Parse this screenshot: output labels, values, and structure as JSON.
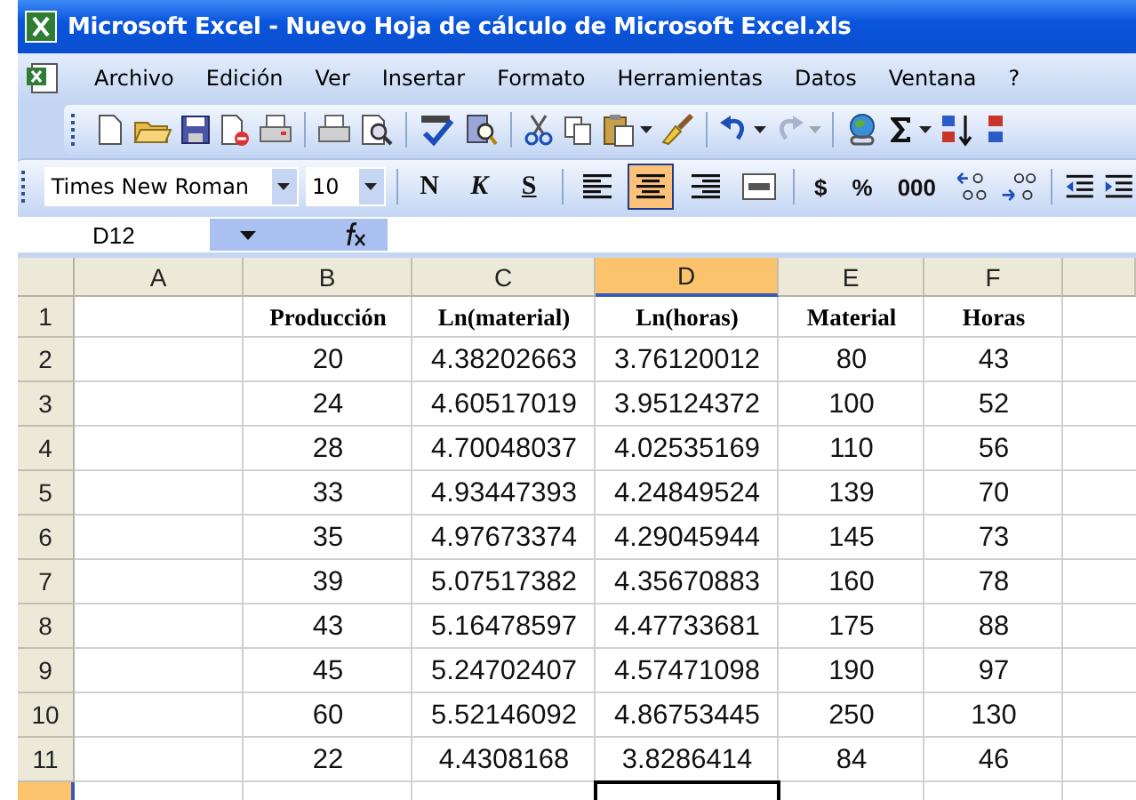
{
  "window": {
    "title": "Microsoft Excel - Nuevo Hoja de cálculo de Microsoft Excel.xls"
  },
  "menu": [
    {
      "label": "Archivo"
    },
    {
      "label": "Edición"
    },
    {
      "label": "Ver"
    },
    {
      "label": "Insertar"
    },
    {
      "label": "Formato"
    },
    {
      "label": "Herramientas"
    },
    {
      "label": "Datos"
    },
    {
      "label": "Ventana"
    },
    {
      "label": "?"
    }
  ],
  "formatting_toolbar": {
    "font": "Times New Roman",
    "size": "10",
    "style_buttons": [
      "N",
      "K",
      "S"
    ],
    "alignment": [
      {
        "kind": "left",
        "selected": false
      },
      {
        "kind": "center",
        "selected": true
      },
      {
        "kind": "right",
        "selected": false
      },
      {
        "kind": "merge",
        "selected": false
      }
    ],
    "number_buttons": [
      "$",
      "%",
      "000"
    ]
  },
  "name_box": "D12",
  "columns": [
    {
      "label": "A",
      "selected": false
    },
    {
      "label": "B",
      "selected": false
    },
    {
      "label": "C",
      "selected": false
    },
    {
      "label": "D",
      "selected": true
    },
    {
      "label": "E",
      "selected": false
    },
    {
      "label": "F",
      "selected": false
    }
  ],
  "rows": [
    {
      "number": "1",
      "selected": false,
      "kind": "header",
      "cells": [
        "Producción",
        "Ln(material)",
        "Ln(horas)",
        "Material",
        "Horas"
      ]
    },
    {
      "number": "2",
      "selected": false,
      "kind": "data",
      "cells": [
        "20",
        "4.38202663",
        "3.76120012",
        "80",
        "43"
      ]
    },
    {
      "number": "3",
      "selected": false,
      "kind": "data",
      "cells": [
        "24",
        "4.60517019",
        "3.95124372",
        "100",
        "52"
      ]
    },
    {
      "number": "4",
      "selected": false,
      "kind": "data",
      "cells": [
        "28",
        "4.70048037",
        "4.02535169",
        "110",
        "56"
      ]
    },
    {
      "number": "5",
      "selected": false,
      "kind": "data",
      "cells": [
        "33",
        "4.93447393",
        "4.24849524",
        "139",
        "70"
      ]
    },
    {
      "number": "6",
      "selected": false,
      "kind": "data",
      "cells": [
        "35",
        "4.97673374",
        "4.29045944",
        "145",
        "73"
      ]
    },
    {
      "number": "7",
      "selected": false,
      "kind": "data",
      "cells": [
        "39",
        "5.07517382",
        "4.35670883",
        "160",
        "78"
      ]
    },
    {
      "number": "8",
      "selected": false,
      "kind": "data",
      "cells": [
        "43",
        "5.16478597",
        "4.47733681",
        "175",
        "88"
      ]
    },
    {
      "number": "9",
      "selected": false,
      "kind": "data",
      "cells": [
        "45",
        "5.24702407",
        "4.57471098",
        "190",
        "97"
      ]
    },
    {
      "number": "10",
      "selected": false,
      "kind": "data",
      "cells": [
        "60",
        "5.52146092",
        "4.86753445",
        "250",
        "130"
      ]
    },
    {
      "number": "11",
      "selected": false,
      "kind": "data",
      "cells": [
        "22",
        "4.4308168",
        "3.8286414",
        "84",
        "46"
      ]
    },
    {
      "selected": true,
      "kind": "data"
    }
  ]
}
